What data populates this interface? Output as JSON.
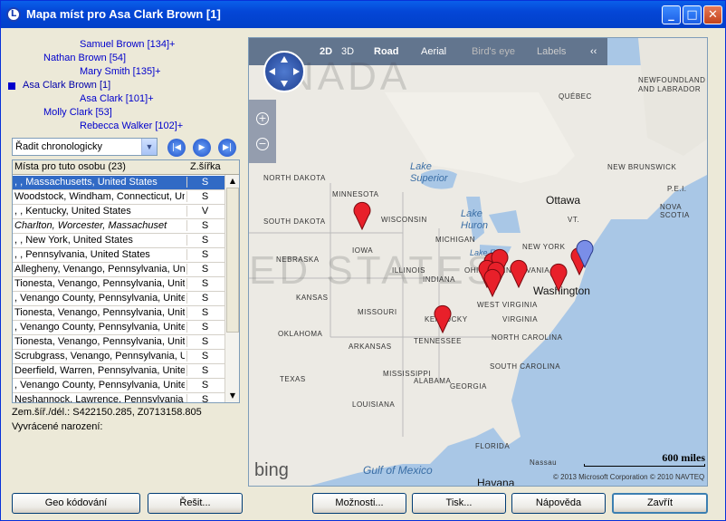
{
  "window": {
    "title": "Mapa míst pro Asa Clark Brown [1]",
    "icon_letter": "L"
  },
  "tree": [
    {
      "label": "Samuel Brown [134]+",
      "selected": false
    },
    {
      "label": "Nathan Brown [54]",
      "selected": false
    },
    {
      "label": "Mary Smith [135]+",
      "selected": false
    },
    {
      "label": "Asa Clark Brown [1]",
      "selected": true
    },
    {
      "label": "Asa Clark [101]+",
      "selected": false
    },
    {
      "label": "Molly Clark [53]",
      "selected": false
    },
    {
      "label": "Rebecca Walker [102]+",
      "selected": false
    }
  ],
  "sort": {
    "selected": "Řadit chronologicky"
  },
  "table": {
    "headers": [
      "Místa pro tuto osobu (23)",
      "Z.šířka"
    ],
    "rows": [
      {
        "place": ", , Massachusetts, United States",
        "lat": "S",
        "selected": true
      },
      {
        "place": "Woodstock, Windham, Connecticut, Uni",
        "lat": "S"
      },
      {
        "place": ", , Kentucky, United States",
        "lat": "V"
      },
      {
        "place": "Charlton, Worcester, Massachuset",
        "lat": "S",
        "italic": true
      },
      {
        "place": ", , New York, United States",
        "lat": "S"
      },
      {
        "place": ", , Pennsylvania, United States",
        "lat": "S"
      },
      {
        "place": "Allegheny, Venango, Pennsylvania, Un",
        "lat": "S"
      },
      {
        "place": "Tionesta, Venango, Pennsylvania, Unite",
        "lat": "S"
      },
      {
        "place": ", Venango County, Pennsylvania, Unite",
        "lat": "S"
      },
      {
        "place": "Tionesta, Venango, Pennsylvania, Unite",
        "lat": "S"
      },
      {
        "place": ", Venango County, Pennsylvania, Unite",
        "lat": "S"
      },
      {
        "place": "Tionesta, Venango, Pennsylvania, Unite",
        "lat": "S"
      },
      {
        "place": "Scrubgrass, Venango, Pennsylvania, U",
        "lat": "S"
      },
      {
        "place": "Deerfield, Warren, Pennsylvania, Unite",
        "lat": "S"
      },
      {
        "place": ", Venango County, Pennsylvania, Unite",
        "lat": "S"
      },
      {
        "place": "Neshannock, Lawrence, Pennsylvania",
        "lat": "S"
      }
    ]
  },
  "coords": "Zem.šíř./dél.: S422150.285, Z0713158.805",
  "disproved": "Vyvrácené narození:",
  "map": {
    "toolbar": [
      "2D",
      "3D",
      "Road",
      "Aerial",
      "Bird's eye",
      "Labels",
      "‹‹"
    ],
    "labels": {
      "north_dakota": "NORTH DAKOTA",
      "minnesota": "MINNESOTA",
      "wisconsin": "WISCONSIN",
      "south_dakota": "SOUTH DAKOTA",
      "iowa": "IOWA",
      "nebraska": "NEBRASKA",
      "illinois": "ILLINOIS",
      "indiana": "INDIANA",
      "ohio": "OHIO",
      "michigan": "MICHIGAN",
      "kansas": "KANSAS",
      "missouri": "MISSOURI",
      "kentucky": "KENTUCKY",
      "west_virginia": "WEST VIRGINIA",
      "virginia": "VIRGINIA",
      "oklahoma": "OKLAHOMA",
      "tennessee": "TENNESSEE",
      "arkansas": "ARKANSAS",
      "north_carolina": "NORTH CAROLINA",
      "south_carolina": "SOUTH CAROLINA",
      "mississippi": "MISSISSIPPI",
      "alabama": "ALABAMA",
      "georgia": "GEORGIA",
      "texas": "TEXAS",
      "louisiana": "LOUISIANA",
      "florida": "FLORIDA",
      "new_york": "NEW YORK",
      "pennsylvania": "PENNSYLVANIA",
      "quebec": "QUÉBEC",
      "newfoundland": "NEWFOUNDLAND AND LABRADOR",
      "new_brunswick": "NEW BRUNSWICK",
      "pei": "P.E.I.",
      "nova_scotia": "NOVA SCOTIA",
      "vt": "VT.",
      "nada": "NADA",
      "united_states": "ED STATES"
    },
    "cities": {
      "ottawa": "Ottawa",
      "washington": "Washington",
      "havana": "Havana",
      "nassau": "Nassau"
    },
    "water": {
      "lake_superior": "Lake Superior",
      "lake_huron": "Lake Huron",
      "lake_erie": "Lake Erie",
      "gulf": "Gulf of Mexico"
    },
    "scale": "600 miles",
    "copyright": "© 2013 Microsoft Corporation   © 2010 NAVTEQ",
    "brand": "bing"
  },
  "buttons": {
    "geocode": "Geo kódování",
    "solve": "Řešit...",
    "options": "Možnosti...",
    "print": "Tisk...",
    "help": "Nápověda",
    "close": "Zavřít"
  }
}
